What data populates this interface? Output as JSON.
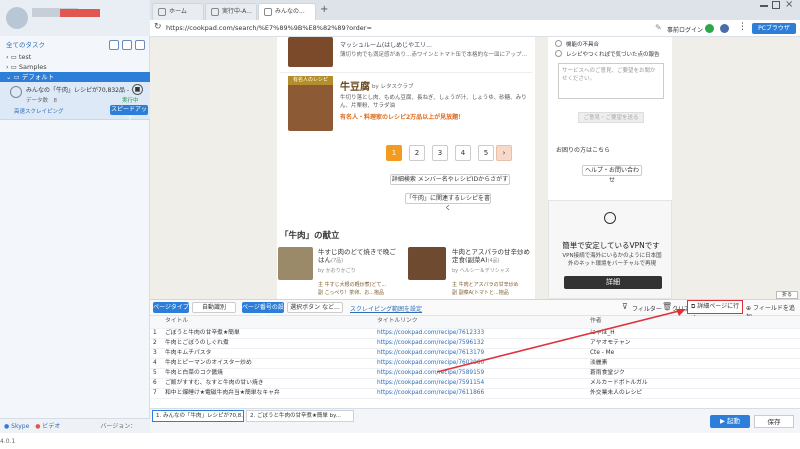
{
  "sidebar": {
    "tree_root": "全てのタスク",
    "folders": [
      "test",
      "Samples",
      "デフォルト"
    ],
    "task": {
      "title": "みんなの「牛肉」レシピが70,832品 - クッ...",
      "data_label": "データ数",
      "data_count": "8",
      "status": "実行中",
      "mode": "高速スクレイピング",
      "speedup_label": "スピードアップ"
    },
    "footer": {
      "help": "Skype",
      "video": "ビデオ",
      "version": "バージョン：4.0.1"
    }
  },
  "browser": {
    "tabs": [
      "ホーム",
      "実行中-A...",
      "みんなの..."
    ],
    "url": "https://cookpad.com/search/%E7%89%9B%E8%82%89?order=",
    "login_label": "事前ログイン",
    "browser_button": "PCブラウザ"
  },
  "page": {
    "recipe_top_snippet": "マッシュルーム(はしめじやエリ...",
    "recipe_top_desc": "薄切り肉でも満足感があり…赤ワインとトマト缶で本格的な一皿にアップ…",
    "recipe_badge": "有名人のレシピ",
    "recipe_title": "牛豆腐",
    "recipe_author": "by レタスクラブ",
    "recipe_desc": "牛切り落とし肉、もめん豆腐、長ねぎ、しょうが汁、しょうゆ、砂糖、みりん、片栗粉、サラダ油",
    "recipe_promo": "有名人・料理家のレシピ2万品以上が見放題！",
    "pages": [
      "1",
      "2",
      "3",
      "4",
      "5"
    ],
    "next_arrow": "›",
    "search_detail": "詳細検索 メンバー名やレシピIDからさがす",
    "write_recipe": "「牛肉」に関連するレシピを書く",
    "kondate_title": "「牛肉」の献立",
    "kondate": [
      {
        "title": "牛すじ肉のどて焼きで晩ごはん",
        "count": "(7品)",
        "author": "by かおりかごり",
        "items": [
          "主 牛すじ大根の軽炒煮(どて...",
          "副 こっぺり！茶卵、お...抱品"
        ]
      },
      {
        "title": "牛肉とアスパラの甘辛炒め定食(副菜A)",
        "count": "(4品)",
        "author": "by ヘルシー＆デリシャス",
        "items": [
          "主 牛肉とアスパラの甘辛炒め",
          "副 副菜A(トマトと...抱品"
        ]
      }
    ]
  },
  "right_panel": {
    "checks": [
      "機能の不具合",
      "レシピやつくれぽで気づいた点の報告"
    ],
    "textarea_placeholder": "サービスへのご意見、ご要望をお聞かせください。",
    "send_label": "ご意見・ご要望を送る",
    "help_heading": "お困りの方はこちら",
    "help_button": "ヘルプ・お問い合わせ",
    "ad_title": "簡単で安定しているVPNです",
    "ad_text": "VPN接続で海外にいるかのように日本国外のネット環境をバーチャルで再現",
    "ad_button": "詳細",
    "fold_label": "折る"
  },
  "flow": {
    "page_type_label": "ページタイプ",
    "page_type_value": "自動識別",
    "paging_label": "ページ番号の設定",
    "paging_value": "選択ボタン など...",
    "scroll_range": "スクレイピング範囲を設定",
    "filter": "フィルター",
    "clear": "クリア",
    "detail_page": "詳細ページに行く",
    "add_field": "フィールドを追加"
  },
  "table": {
    "headers": [
      "",
      "タイトル",
      "タイトルリンク",
      "作者"
    ],
    "rows": [
      [
        "1",
        "ごぼうと牛肉の甘辛煮★簡単",
        "https://cookpad.com/recipe/7612333",
        "にゃほ_H"
      ],
      [
        "2",
        "牛肉とごぼうのしぐれ煮",
        "https://cookpad.com/recipe/7596132",
        "アヤオモテャン"
      ],
      [
        "3",
        "牛肉キムチパスタ",
        "https://cookpad.com/recipe/7613179",
        "Cte - Me"
      ],
      [
        "4",
        "牛肉とピーマンのオイスター炒め",
        "https://cookpad.com/recipe/7602060",
        "淡麗素"
      ],
      [
        "5",
        "牛肉と白菜のコク醤焼",
        "https://cookpad.com/recipe/7589159",
        "蒼雨食堂ジク"
      ],
      [
        "6",
        "ご飯がすすむ、なすと牛肉の甘い焼き",
        "https://cookpad.com/recipe/7591154",
        "メルカードボトルガル"
      ],
      [
        "7",
        "和中と爆睡け★電磁牛肉弁当★簡単なキャ弁",
        "https://cookpad.com/recipe/7611866",
        "外交業未人のレシピ"
      ]
    ]
  },
  "bottom": {
    "tabs": [
      "1. みんなの「牛肉」レシピが70,8...",
      "2. ごぼうと牛肉の甘辛煮★簡単 by..."
    ],
    "start": "起動",
    "save": "保存"
  },
  "colors": {
    "accent": "#2d7ed8",
    "orange": "#f29b1e",
    "annotation": "#e0303a"
  }
}
